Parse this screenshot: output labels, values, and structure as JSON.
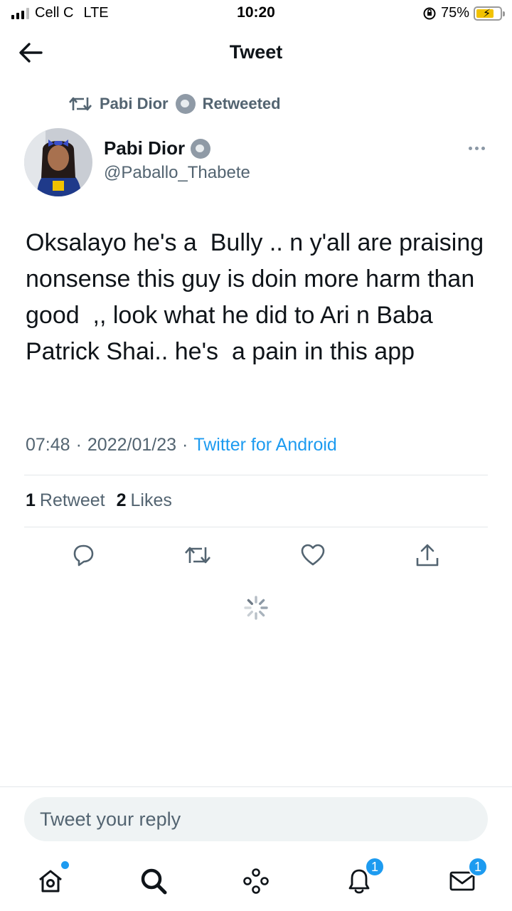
{
  "status_bar": {
    "carrier": "Cell C",
    "network": "LTE",
    "time": "10:20",
    "battery_percent": "75%",
    "battery_level": 0.75
  },
  "header": {
    "title": "Tweet"
  },
  "retweet_context": {
    "name": "Pabi Dior",
    "action": "Retweeted"
  },
  "author": {
    "name": "Pabi Dior",
    "handle": "@Paballo_Thabete"
  },
  "tweet": {
    "text": "Oksalayo he's a  Bully .. n y'all are praising nonsense this guy is doin more harm than good  ,, look what he did to Ari n Baba Patrick Shai.. he's  a pain in this app",
    "time": "07:48",
    "date": "2022/01/23",
    "source": "Twitter for Android",
    "separator": "·"
  },
  "stats": {
    "retweet_count": "1",
    "retweet_label": "Retweet",
    "like_count": "2",
    "like_label": "Likes"
  },
  "reply": {
    "placeholder": "Tweet your reply"
  },
  "tab_bar": {
    "notifications_badge": "1",
    "messages_badge": "1"
  },
  "colors": {
    "accent": "#1d9bf0",
    "secondary_text": "#536471",
    "primary_text": "#0f1419"
  }
}
